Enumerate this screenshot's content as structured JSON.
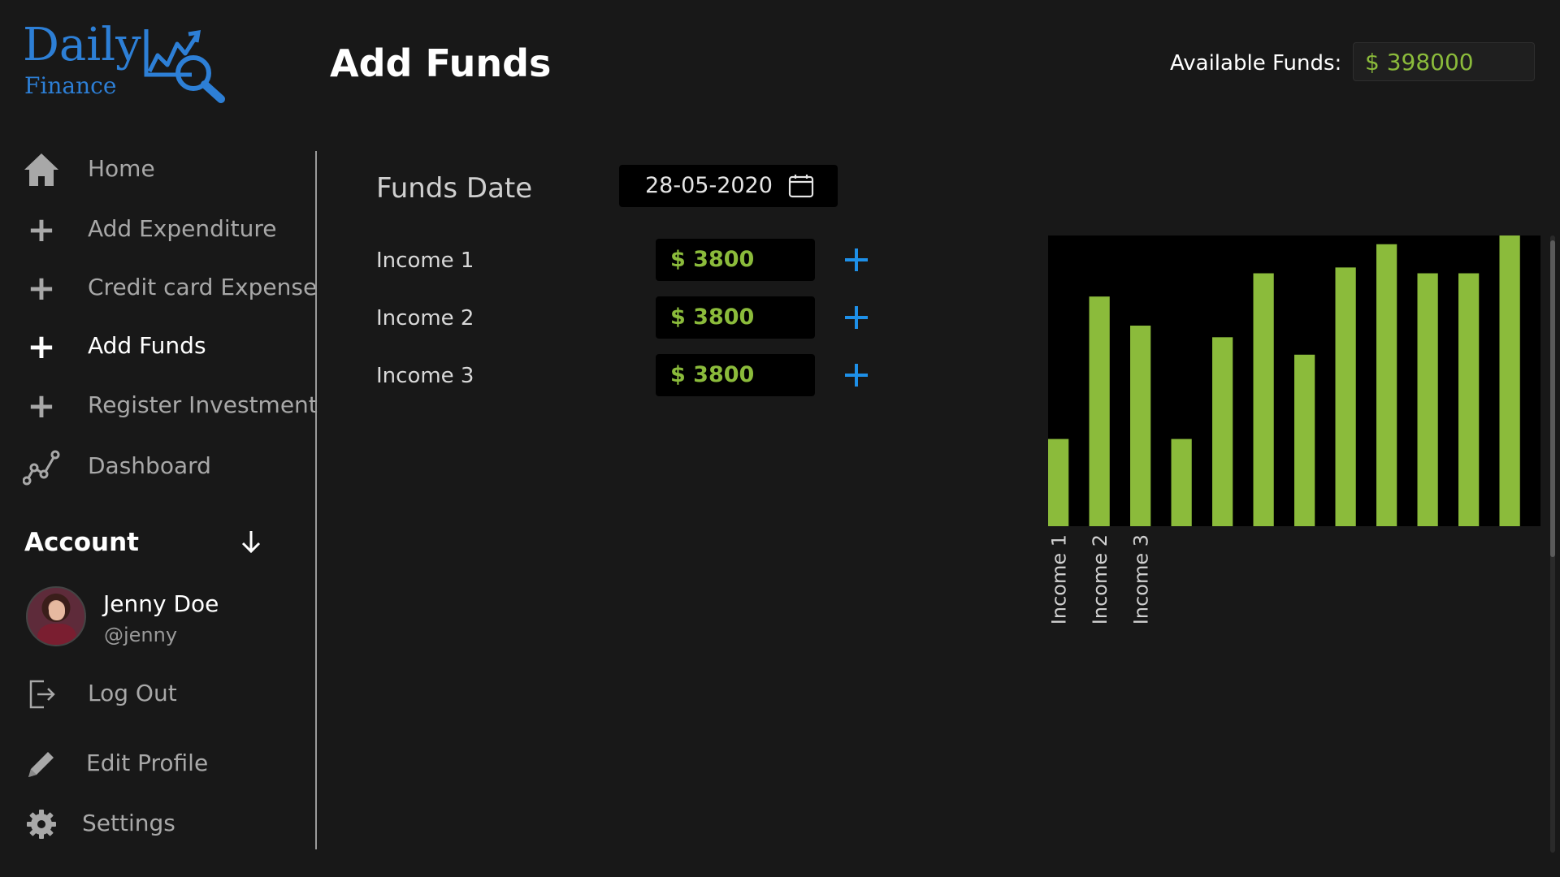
{
  "brand": {
    "name": "Daily",
    "sub": "Finance",
    "color": "#2d7fd6",
    "icon": "chart-magnifier-icon"
  },
  "header": {
    "title": "Add Funds",
    "available_label": "Available Funds:",
    "available_value": "$ 398000"
  },
  "sidebar": {
    "items": [
      {
        "label": "Home",
        "icon": "home-icon"
      },
      {
        "label": "Add Expenditure",
        "icon": "plus-icon"
      },
      {
        "label": "Credit card Expense",
        "icon": "plus-icon"
      },
      {
        "label": "Add Funds",
        "icon": "plus-icon",
        "active": true
      },
      {
        "label": "Register Investment",
        "icon": "plus-icon"
      },
      {
        "label": "Dashboard",
        "icon": "line-chart-icon"
      }
    ],
    "account_title": "Account",
    "user": {
      "name": "Jenny Doe",
      "handle": "@jenny"
    },
    "logout_label": "Log Out",
    "edit_profile_label": "Edit Profile",
    "settings_label": "Settings"
  },
  "form": {
    "date_label": "Funds Date",
    "date_value": "28-05-2020",
    "incomes": [
      {
        "label": "Income 1",
        "value": "$ 3800"
      },
      {
        "label": "Income 2",
        "value": "$ 3800"
      },
      {
        "label": "Income 3",
        "value": "$ 3800"
      }
    ]
  },
  "colors": {
    "accent_green": "#8bbb3b",
    "accent_blue": "#1e90e8",
    "background": "#181818"
  },
  "chart_data": {
    "type": "bar",
    "categories": [
      "Income 1",
      "Income 2",
      "Income 3",
      "",
      "",
      "",
      "",
      "",
      "",
      "",
      "",
      ""
    ],
    "values": [
      30,
      79,
      69,
      30,
      65,
      87,
      59,
      89,
      97,
      87,
      87,
      100
    ],
    "ylim": [
      0,
      100
    ],
    "bar_color": "#8bbb3b",
    "plot_background": "#000000",
    "grid": false
  }
}
